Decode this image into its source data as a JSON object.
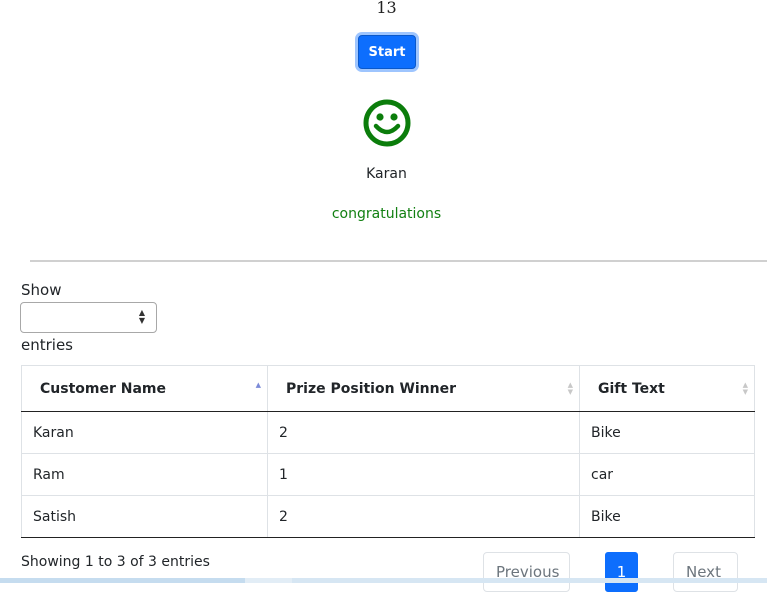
{
  "game": {
    "counter": "13",
    "start_label": "Start",
    "winner_name": "Karan",
    "message": "congratulations"
  },
  "colors": {
    "primary": "#0d6efd",
    "success": "#128012"
  },
  "icons": {
    "face": "smiley-face-icon"
  },
  "length_menu": {
    "prefix": "Show",
    "selected": "",
    "suffix": "entries"
  },
  "table": {
    "columns": [
      "Customer Name",
      "Prize Position Winner",
      "Gift Text"
    ],
    "rows": [
      [
        "Karan",
        "2",
        "Bike"
      ],
      [
        "Ram",
        "1",
        "car"
      ],
      [
        "Satish",
        "2",
        "Bike"
      ]
    ]
  },
  "footer": {
    "info": "Showing 1 to 3 of 3 entries",
    "previous": "Previous",
    "page": "1",
    "next": "Next"
  }
}
